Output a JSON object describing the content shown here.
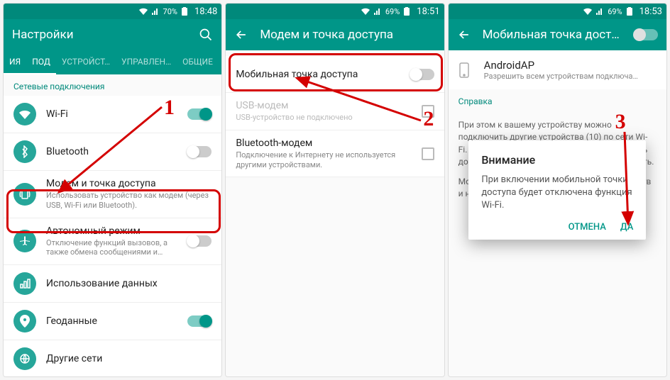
{
  "annotations": {
    "step1": "1",
    "step2": "2",
    "step3": "3"
  },
  "screen1": {
    "status": {
      "battery": "70%",
      "time": "18:48"
    },
    "title": "Настройки",
    "tabs": [
      "ИЯ",
      "ПОД",
      "УСТРОЙСТ…",
      "УПРАВЛЕН…",
      "ОБЩИЕ"
    ],
    "section": "Сетевые подключения",
    "items": [
      {
        "label": "Wi-Fi",
        "sub": "",
        "switch": "on"
      },
      {
        "label": "Bluetooth",
        "sub": "",
        "switch": "off"
      },
      {
        "label": "Модем и точка доступа",
        "sub": "Использовать устройство как модем (через USB, Wi-Fi или Bluetooth)."
      },
      {
        "label": "Автономный режим",
        "sub": "Отключение функций вызовов, а также обмена сообщениями и…",
        "switch": "off"
      },
      {
        "label": "Использование данных",
        "sub": ""
      },
      {
        "label": "Геоданные",
        "sub": "",
        "switch": "on"
      },
      {
        "label": "Другие сети",
        "sub": ""
      }
    ]
  },
  "screen2": {
    "status": {
      "battery": "69%",
      "time": "18:51"
    },
    "title": "Модем и точка доступа",
    "items": [
      {
        "label": "Мобильная точка доступа",
        "sub": "",
        "control": "switch-off"
      },
      {
        "label": "USB-модем",
        "sub": "USB-устройство не подключено",
        "control": "checkbox",
        "disabled": true
      },
      {
        "label": "Bluetooth-модем",
        "sub": "Подключение к Интернету не используется другими устройствами.",
        "control": "checkbox"
      }
    ]
  },
  "screen3": {
    "status": {
      "battery": "69%",
      "time": "18:53"
    },
    "title": "Мобильная точка дост…",
    "ap": {
      "name": "AndroidAP",
      "sub": "Разрешить всем устройствам подключа…"
    },
    "help_header": "Справка",
    "help": [
      "При этом к вашему устройству можно подключить другие устройства (10) по сети Wi-Fi. Подключенные устройства смогут получить доступ к Интернету через вашу мобильную сеть.",
      "Можно создать список разрешенных устройств и настроить для них режим подключения."
    ],
    "dialog": {
      "title": "Внимание",
      "body": "При включении мобильной точки доступа будет отключена функция Wi-Fi.",
      "cancel": "ОТМЕНА",
      "ok": "ДА"
    }
  }
}
